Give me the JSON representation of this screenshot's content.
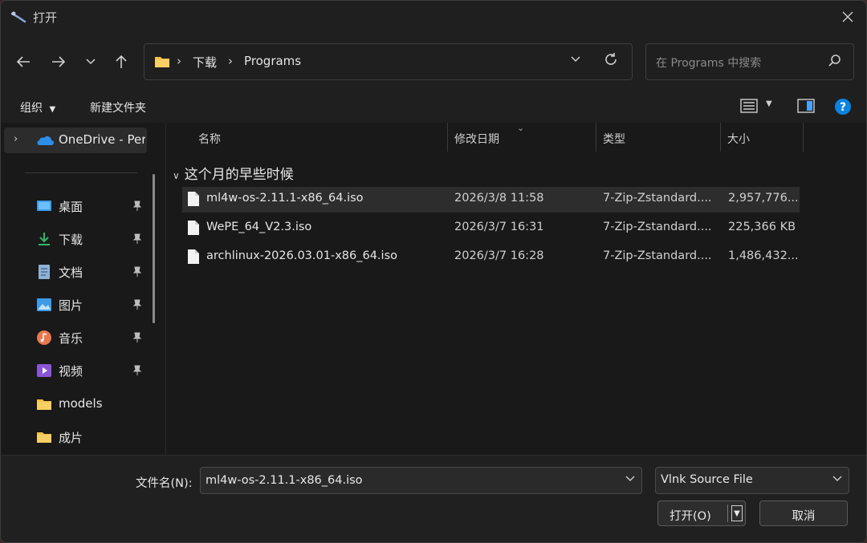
{
  "window": {
    "title": "打开"
  },
  "nav": {
    "breadcrumbs": [
      "下载",
      "Programs"
    ],
    "search_placeholder": "在 Programs 中搜索"
  },
  "commands": {
    "organize": "组织",
    "new_folder": "新建文件夹"
  },
  "sidebar": {
    "onedrive": "OneDrive - Per",
    "items": [
      {
        "label": "桌面",
        "icon": "desktop-icon",
        "pinned": true
      },
      {
        "label": "下载",
        "icon": "download-icon",
        "pinned": true
      },
      {
        "label": "文档",
        "icon": "document-icon",
        "pinned": true
      },
      {
        "label": "图片",
        "icon": "pictures-icon",
        "pinned": true
      },
      {
        "label": "音乐",
        "icon": "music-icon",
        "pinned": true
      },
      {
        "label": "视频",
        "icon": "video-icon",
        "pinned": true
      },
      {
        "label": "models",
        "icon": "folder-icon",
        "pinned": false
      },
      {
        "label": "成片",
        "icon": "folder-icon",
        "pinned": false
      }
    ]
  },
  "columns": {
    "name": "名称",
    "date": "修改日期",
    "type": "类型",
    "size": "大小"
  },
  "group": {
    "label": "这个月的早些时候"
  },
  "files": [
    {
      "name": "ml4w-os-2.11.1-x86_64.iso",
      "date": "2026/3/8 11:58",
      "type": "7-Zip-Zstandard....",
      "size": "2,957,776...",
      "selected": true
    },
    {
      "name": "WePE_64_V2.3.iso",
      "date": "2026/3/7 16:31",
      "type": "7-Zip-Zstandard....",
      "size": "225,366 KB",
      "selected": false
    },
    {
      "name": "archlinux-2026.03.01-x86_64.iso",
      "date": "2026/3/7 16:28",
      "type": "7-Zip-Zstandard....",
      "size": "1,486,432...",
      "selected": false
    }
  ],
  "footer": {
    "filename_label": "文件名(N):",
    "filename_value": "ml4w-os-2.11.1-x86_64.iso",
    "filetype_value": "Vlnk Source File",
    "open_label": "打开(O)",
    "cancel_label": "取消"
  },
  "colors": {
    "accent": "#0a84e0",
    "folder": "#f3c04a",
    "background": "#1c1c1c"
  }
}
